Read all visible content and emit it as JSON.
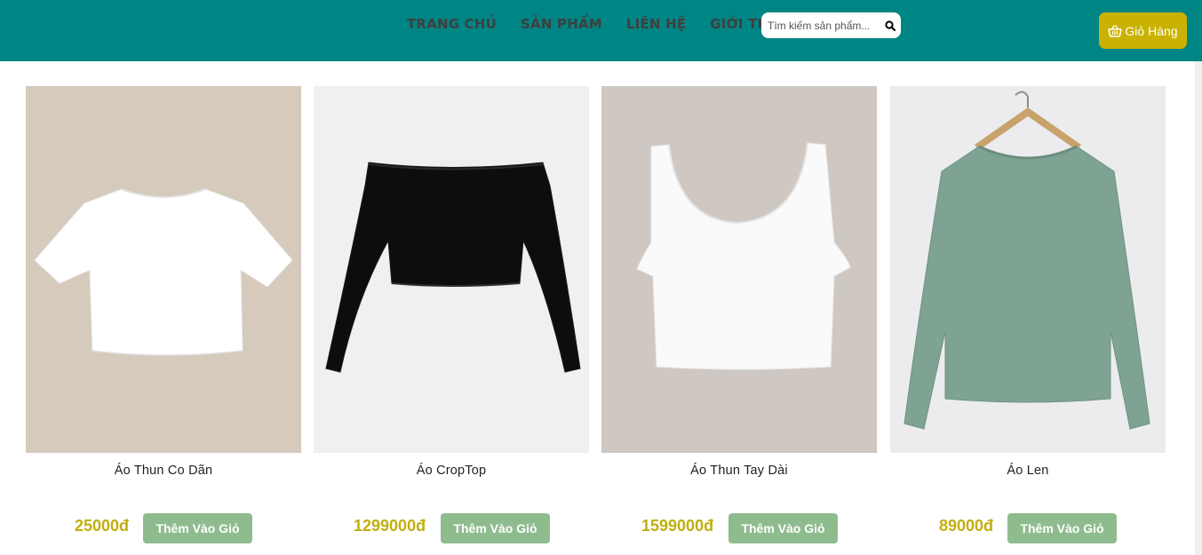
{
  "header": {
    "nav": [
      "TRANG CHỦ",
      "SẢN PHẨM",
      "LIÊN HỆ",
      "GIỚI THIỆU"
    ],
    "search_placeholder": "Tìm kiếm sản phẩm...",
    "search_icon": "search-icon",
    "cart_label": "Giỏ Hàng",
    "cart_icon": "basket-icon",
    "colors": {
      "bar": "#008585",
      "cart": "#c9b200"
    }
  },
  "products": [
    {
      "name": "Áo Thun Co Dãn",
      "price": "25000đ",
      "button": "Thêm Vào Giỏ"
    },
    {
      "name": "Áo CropTop",
      "price": "1299000đ",
      "button": "Thêm Vào Giỏ"
    },
    {
      "name": "Áo Thun Tay Dài",
      "price": "1599000đ",
      "button": "Thêm Vào Giỏ"
    },
    {
      "name": "Áo Len",
      "price": "89000đ",
      "button": "Thêm Vào Giỏ"
    }
  ],
  "colors": {
    "price": "#c2ae0e",
    "add_button": "#8fbc8f"
  }
}
